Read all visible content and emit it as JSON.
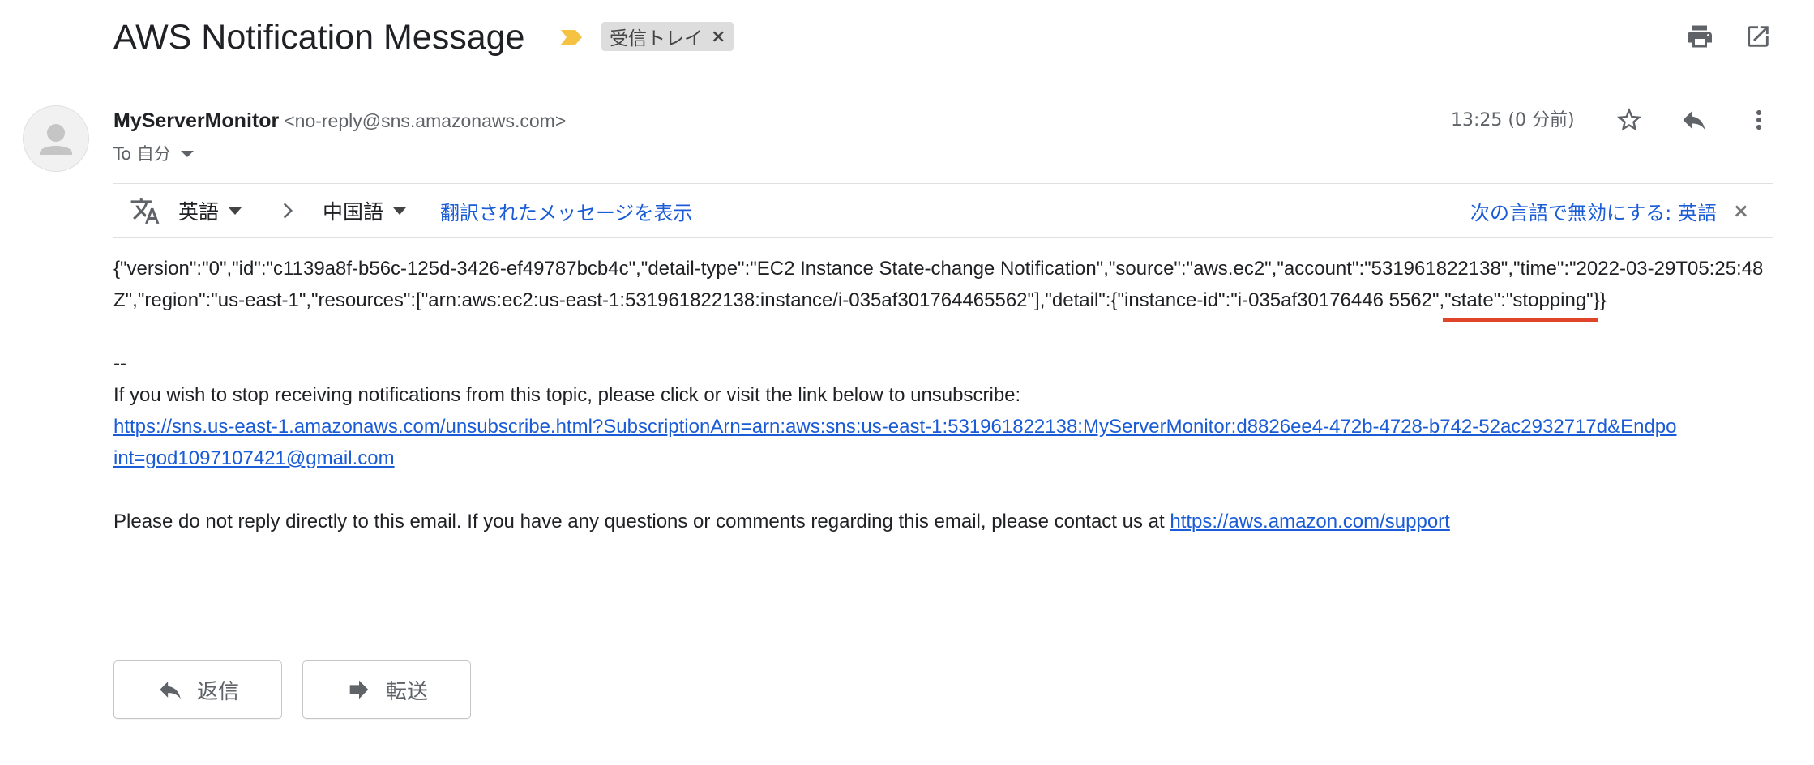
{
  "email": {
    "subject": "AWS Notification Message",
    "label": "受信トレイ",
    "sender_name": "MyServerMonitor",
    "sender_email": "<no-reply@sns.amazonaws.com>",
    "recipient": "To 自分",
    "time": "13:25 (0 分前)"
  },
  "translate": {
    "source_language": "英語",
    "target_language": "中国語",
    "show_translation": "翻訳されたメッセージを表示",
    "disable_for": "次の言語で無効にする: 英語"
  },
  "body": {
    "json_before": "{\"version\":\"0\",\"id\":\"c1139a8f-b56c-125d-3426-ef49787bcb4c\",\"detail-type\":\"EC2 Instance State-change Notification\",\"source\":\"aws.ec2\",\"account\":\"531961822138\",\"time\":\"2022-03-29T05:25:48Z\",\"region\":\"us-east-1\",\"resources\":[\"arn:aws:ec2:us-east-1:531961822138:instance/i-035af301764465562\"],\"detail\":{\"instance-id\":\"i-035af30176446 5562\",",
    "json_highlight": "\"state\":\"stopping\"",
    "json_after": "}}",
    "separator": "--",
    "unsubscribe_text": "If you wish to stop receiving notifications from this topic, please click or visit the link below to unsubscribe:",
    "unsubscribe_link": "https://sns.us-east-1.amazonaws.com/unsubscribe.html?SubscriptionArn=arn:aws:sns:us-east-1:531961822138:MyServerMonitor:d8826ee4-472b-4728-b742-52ac2932717d&Endpoint=god1097107421@gmail.com",
    "footer_text": "Please do not reply directly to this email. If you have any questions or comments regarding this email, please contact us at ",
    "support_link": "https://aws.amazon.com/support"
  },
  "actions": {
    "reply": "返信",
    "forward": "転送"
  },
  "colors": {
    "link": "#1a5bd6",
    "highlight_underline": "#e0442b",
    "importance_marker": "#f5c242"
  },
  "icons": [
    "importance-marker-icon",
    "close-icon",
    "print-icon",
    "open-in-new-window-icon",
    "avatar-icon",
    "caret-down-icon",
    "star-icon",
    "reply-icon",
    "more-vert-icon",
    "translate-icon",
    "chevron-right-icon",
    "forward-icon"
  ]
}
